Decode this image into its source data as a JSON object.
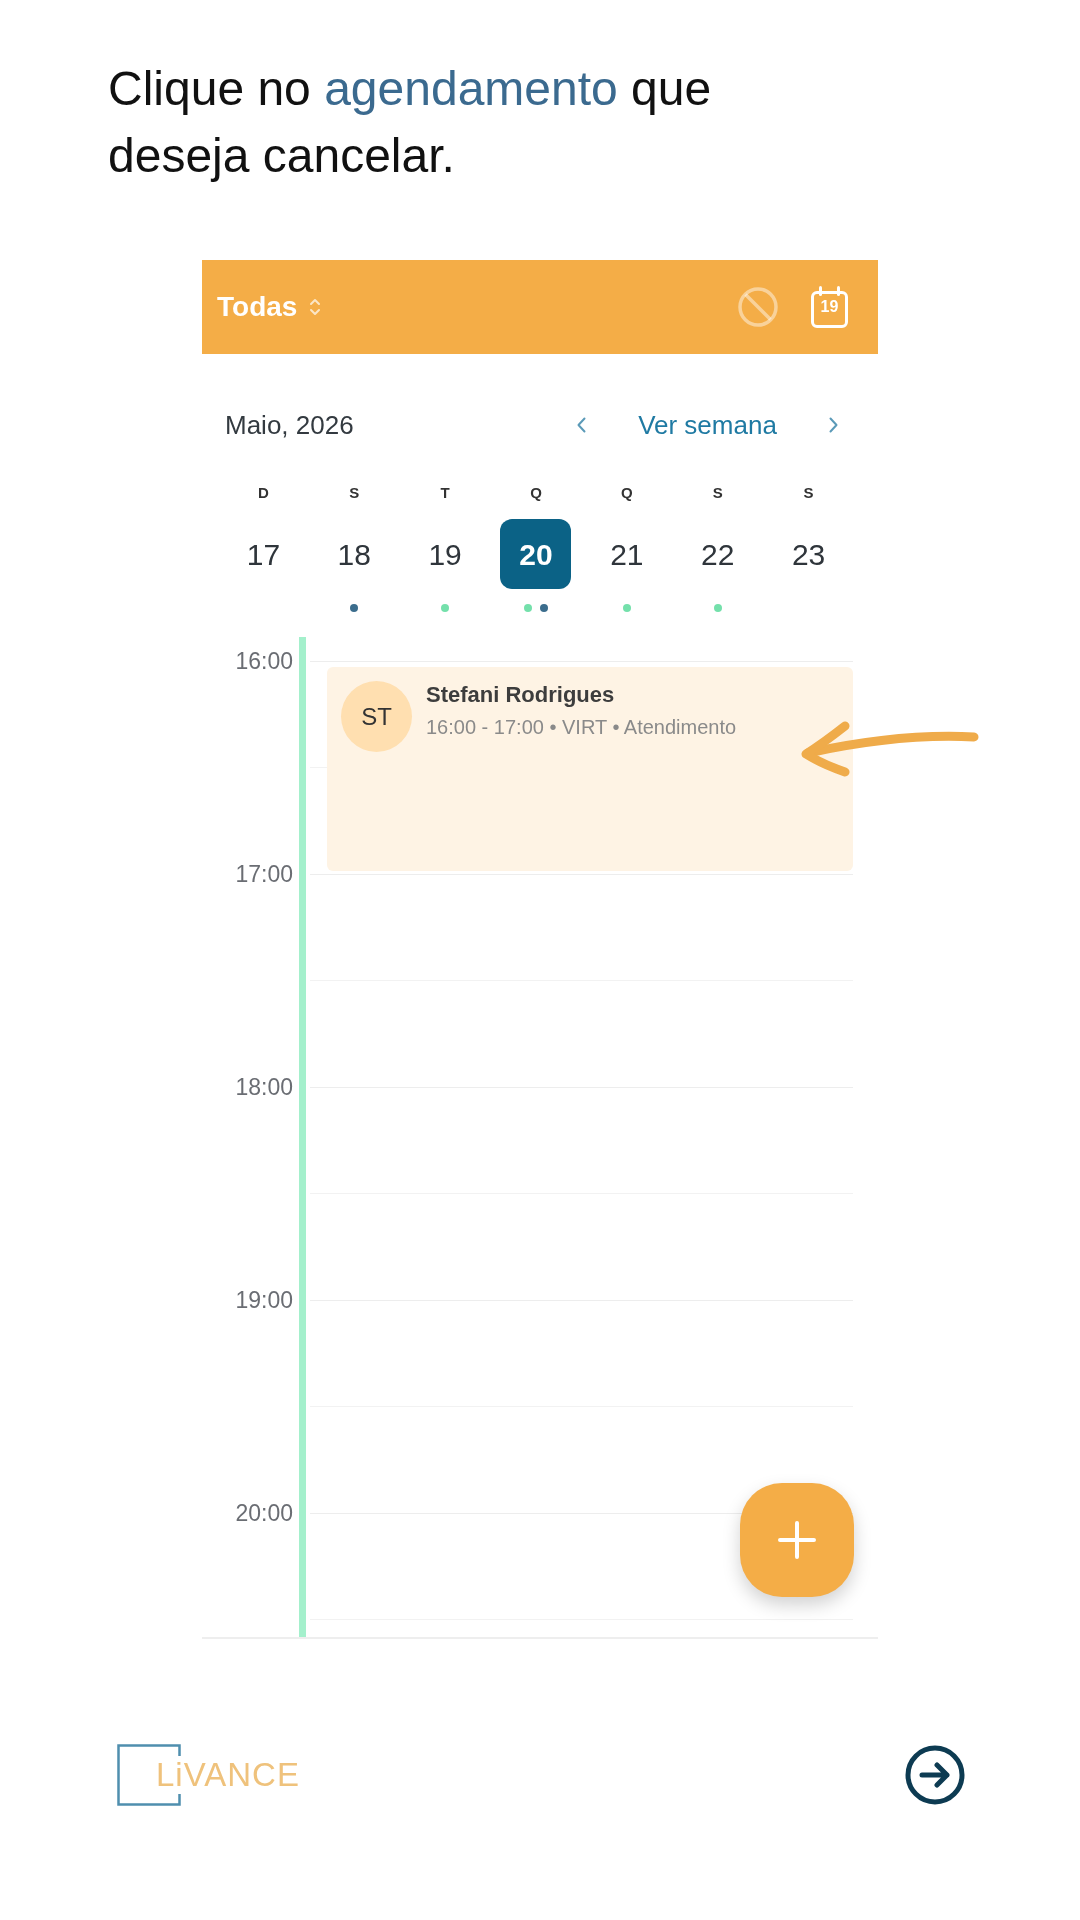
{
  "instruction": {
    "parts": [
      {
        "text": "Clique no",
        "highlight": false
      },
      {
        "text": "agendamento",
        "highlight": true
      },
      {
        "text": "que deseja cancelar.",
        "highlight": false
      }
    ]
  },
  "header": {
    "filter": "Todas",
    "block_button": {
      "disabled": true
    },
    "today_day": "19"
  },
  "calendar": {
    "month": "Maio, 2026",
    "view_toggle": "Ver semana",
    "days": [
      {
        "weekday": "D",
        "day": "17",
        "selected": false
      },
      {
        "weekday": "S",
        "day": "18",
        "selected": false,
        "dots": [
          {
            "color": "#3b6d8d"
          }
        ]
      },
      {
        "weekday": "T",
        "day": "19",
        "selected": false,
        "dots": [
          {
            "color": "#74e0ab"
          }
        ]
      },
      {
        "weekday": "Q",
        "day": "20",
        "selected": true,
        "dots": [
          {
            "color": "#74e0ab"
          },
          {
            "color": "#3b6d8d"
          }
        ]
      },
      {
        "weekday": "Q",
        "day": "21",
        "selected": false,
        "dots": [
          {
            "color": "#74e0ab"
          }
        ]
      },
      {
        "weekday": "S",
        "day": "22",
        "selected": false,
        "dots": [
          {
            "color": "#74e0ab"
          }
        ]
      },
      {
        "weekday": "S",
        "day": "23",
        "selected": false
      }
    ]
  },
  "timeline": {
    "hours": [
      "16:00",
      "17:00",
      "18:00",
      "19:00",
      "20:00"
    ],
    "appointments": [
      {
        "initials": "ST",
        "name": "Stefani Rodrigues",
        "details": "16:00 - 17:00 • VIRT • Atendimento"
      }
    ]
  },
  "footer": {
    "logo": "LiVANCE"
  }
}
